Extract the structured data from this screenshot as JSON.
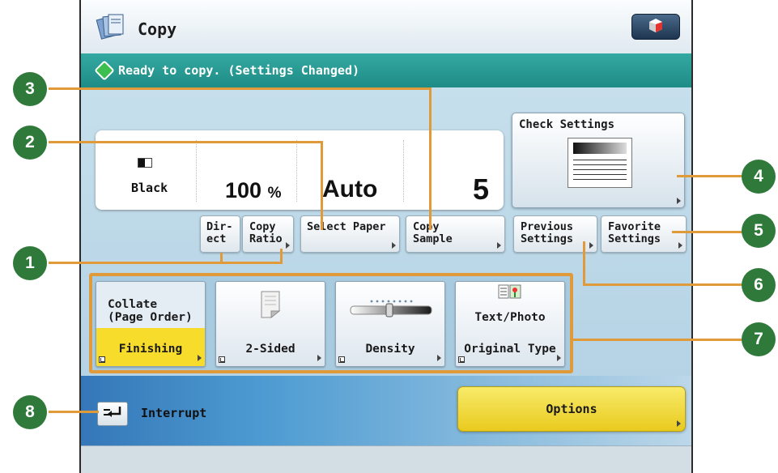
{
  "app": {
    "title": "Copy",
    "status_text": "Ready to copy. (Settings Changed)"
  },
  "info_panel": {
    "color_mode": "Black",
    "copy_ratio_value": "100",
    "copy_ratio_unit": "%",
    "paper": "Auto",
    "copies": "5"
  },
  "buttons": {
    "check_settings": "Check Settings",
    "direct": "Dir-\nect",
    "copy_ratio": "Copy\nRatio",
    "select_paper": "Select Paper",
    "copy_sample": "Copy\nSample",
    "previous_settings": "Previous\nSettings",
    "favorite_settings": "Favorite\nSettings"
  },
  "functions": [
    {
      "top": "Collate\n(Page Order)",
      "label": "Finishing"
    },
    {
      "top": "",
      "label": "2-Sided"
    },
    {
      "top": "",
      "label": "Density"
    },
    {
      "top": "Text/Photo",
      "label": "Original Type"
    }
  ],
  "bottom": {
    "interrupt": "Interrupt",
    "options": "Options"
  },
  "callouts": [
    "1",
    "2",
    "3",
    "4",
    "5",
    "6",
    "7",
    "8"
  ],
  "colors": {
    "callout": "#2f7a3a",
    "leader": "#e09a3a",
    "selected": "#f7dc2b",
    "options": "#e9ca1e",
    "status_bar": "#2a9a93"
  },
  "icons": [
    "copy-app-icon",
    "corner-menu-icon",
    "ready-status-icon",
    "black-mode-icon",
    "check-settings-doc-icon",
    "two-sided-icon",
    "density-slider-icon",
    "text-photo-icon",
    "interrupt-icon",
    "expand-corner-icon",
    "arrow-right-icon"
  ]
}
